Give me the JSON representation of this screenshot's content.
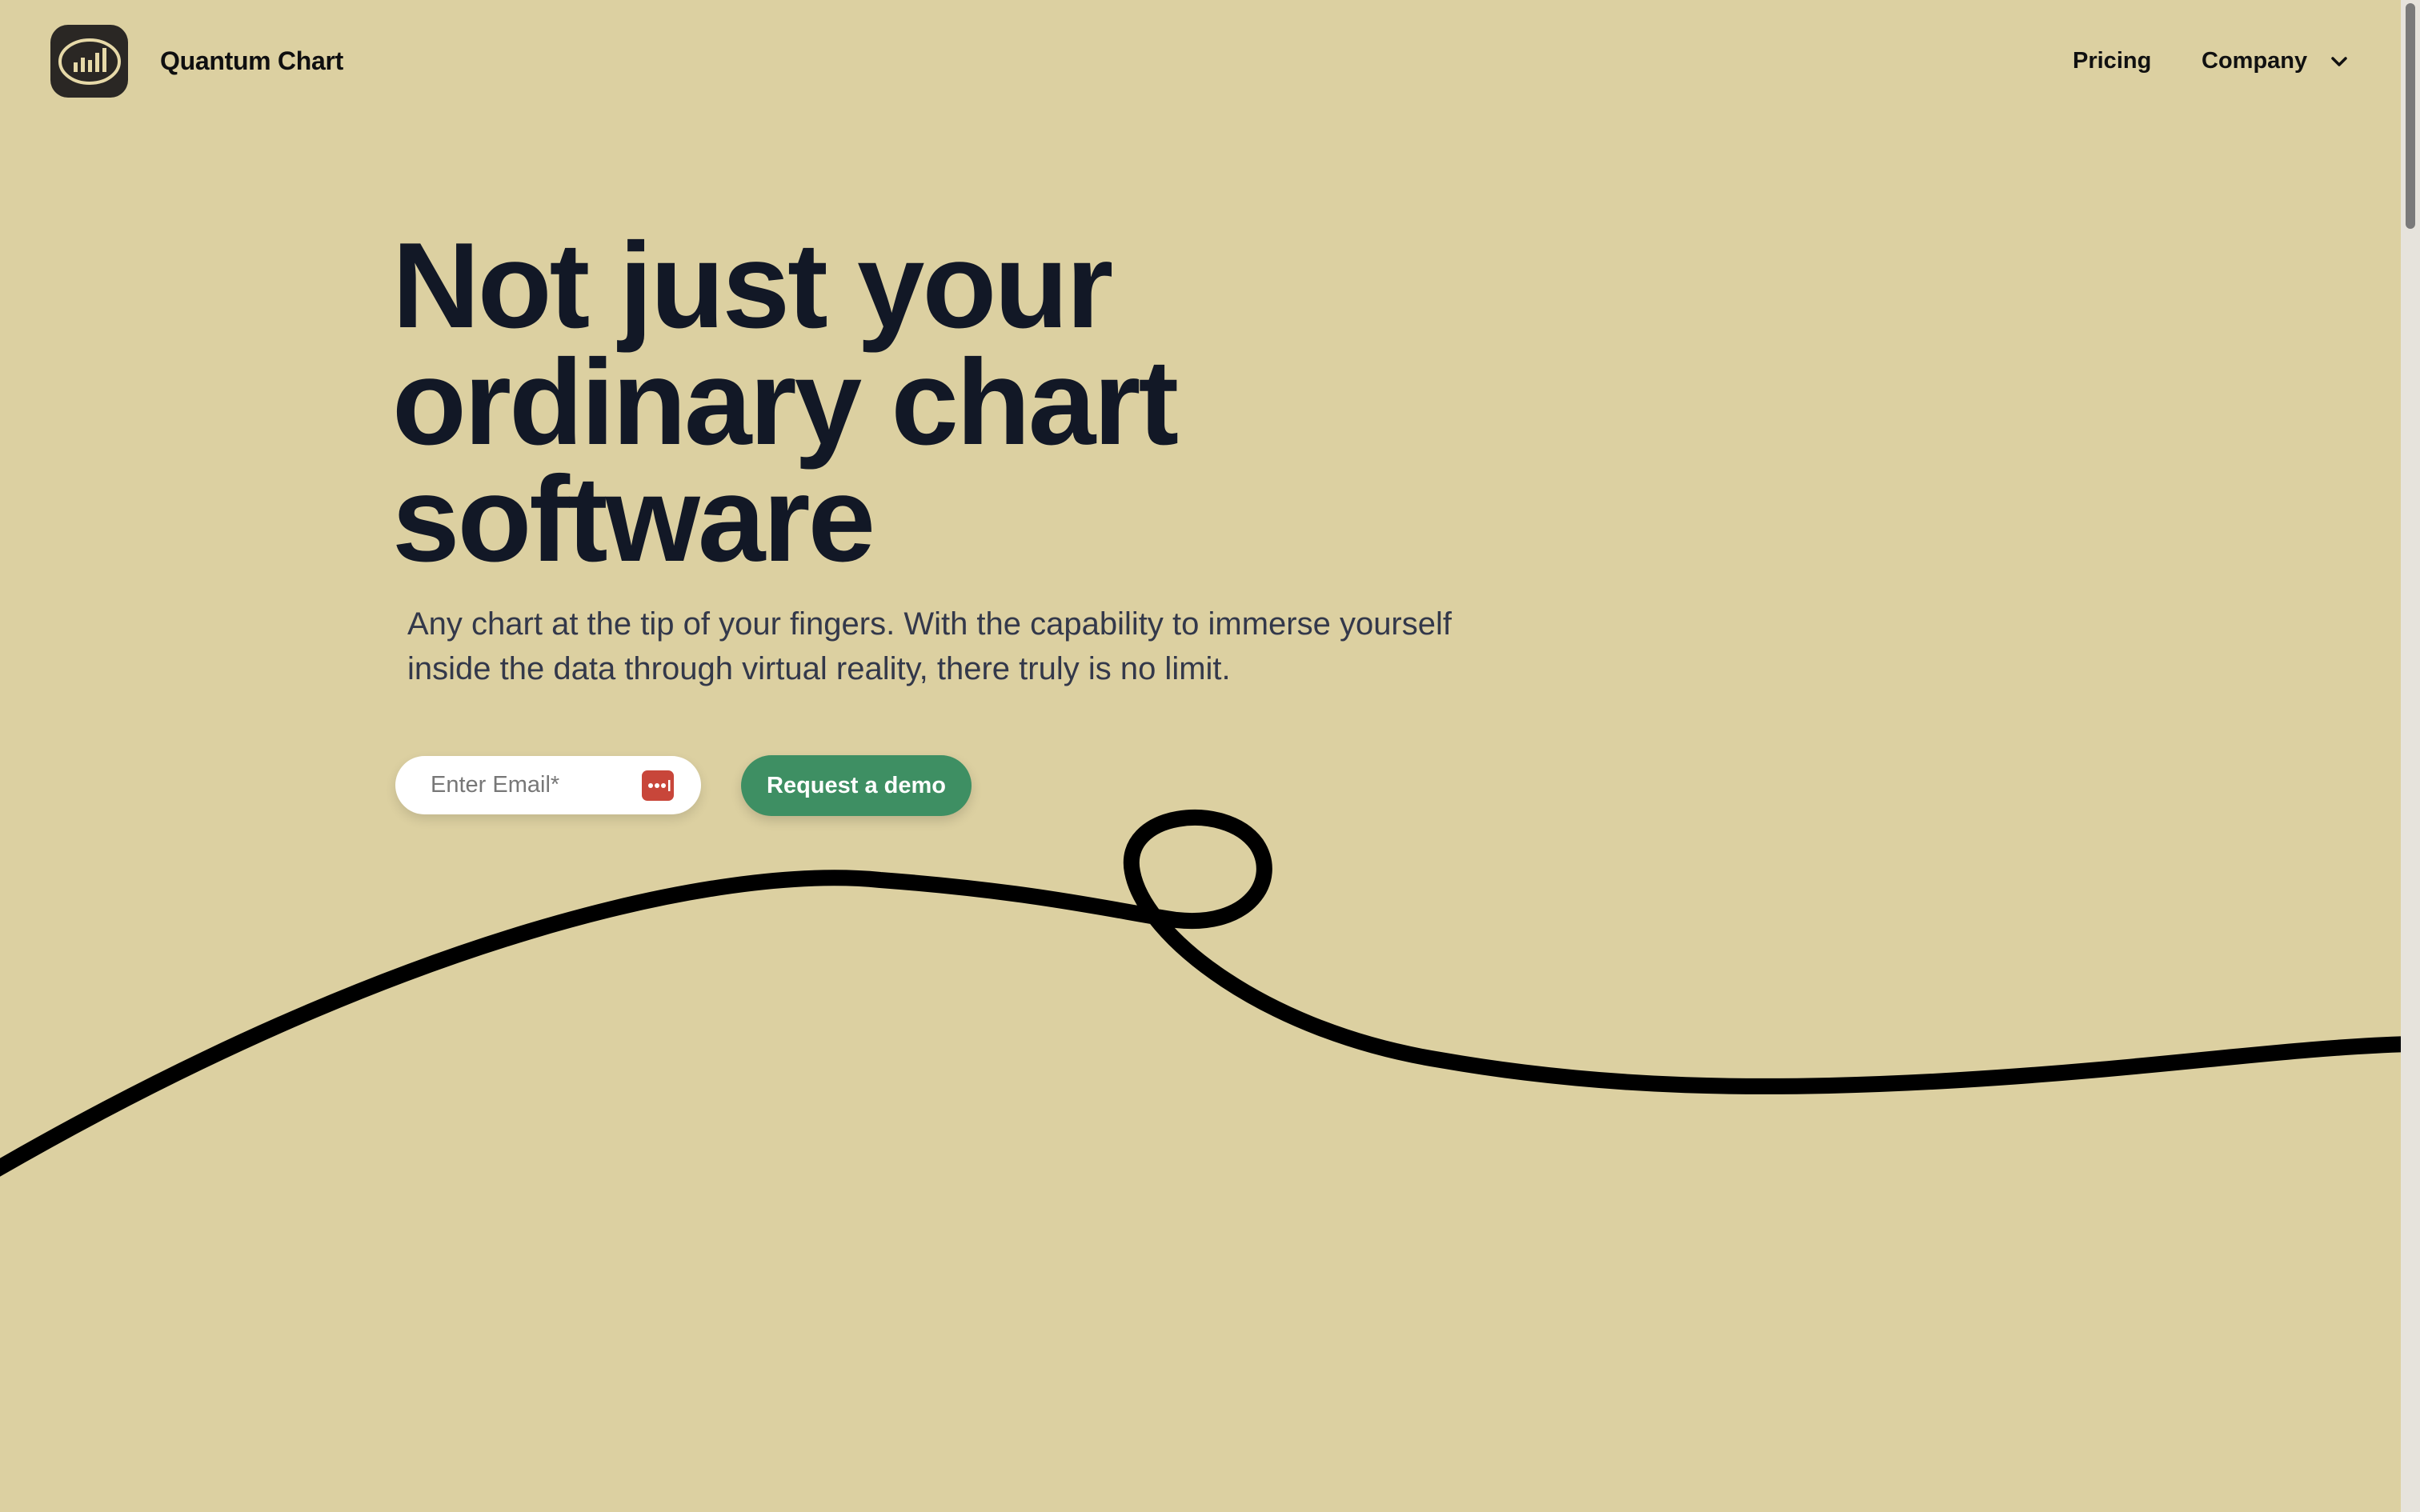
{
  "header": {
    "brand_name": "Quantum Chart",
    "nav": {
      "pricing": "Pricing",
      "company": "Company"
    }
  },
  "hero": {
    "title": "Not just your ordinary chart software",
    "subtitle": "Any chart at the tip of your fingers. With the capability to immerse yourself inside the data through virtual reality, there truly is no limit.",
    "email_placeholder": "Enter Email*",
    "email_value": "",
    "demo_button": "Request a demo"
  },
  "colors": {
    "background": "#dcd0a1",
    "title": "#121826",
    "button": "#3e8f63",
    "logo_badge": "#2a2724",
    "password_manager_icon": "#c8463a"
  },
  "icons": {
    "logo": "chart-logo-icon",
    "company_dropdown": "chevron-down-icon",
    "email_autofill": "password-manager-icon"
  }
}
